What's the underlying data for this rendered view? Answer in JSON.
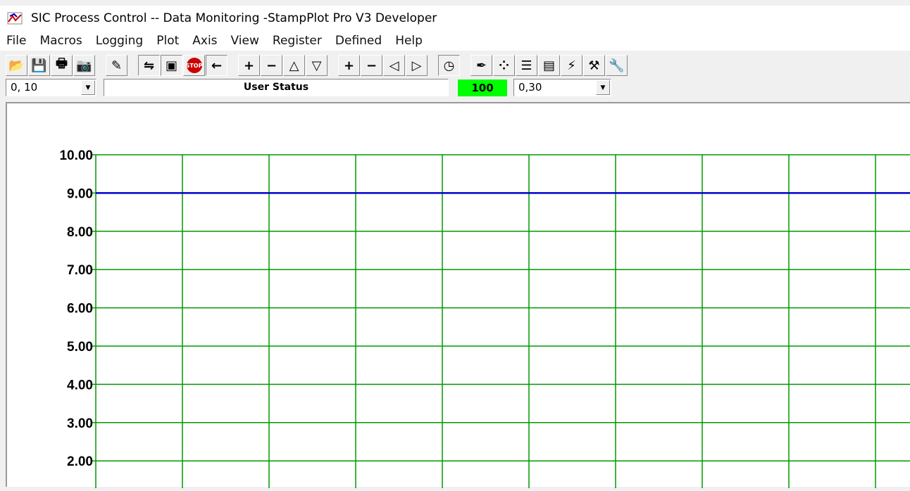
{
  "window": {
    "title": "SIC Process Control -- Data Monitoring  -StampPlot Pro V3 Developer"
  },
  "menu": [
    "File",
    "Macros",
    "Logging",
    "Plot",
    "Axis",
    "View",
    "Register",
    "Defined",
    "Help"
  ],
  "toolbar": [
    {
      "icon": "open-folder-icon",
      "glyph": "📂"
    },
    {
      "icon": "save-icon",
      "glyph": "💾"
    },
    {
      "icon": "print-icon",
      "glyph": "🖶"
    },
    {
      "icon": "camera-icon",
      "glyph": "📷"
    },
    {
      "gap": true
    },
    {
      "icon": "magic-wand-icon",
      "glyph": "✎"
    },
    {
      "gap": true
    },
    {
      "icon": "connect-icon",
      "glyph": "⇋",
      "pressed": true
    },
    {
      "icon": "monitor-icon",
      "glyph": "▣",
      "pressed": true
    },
    {
      "icon": "stop-icon",
      "glyph": "STOP"
    },
    {
      "icon": "arrow-left-icon",
      "glyph": "←",
      "pressed": true
    },
    {
      "gap": true
    },
    {
      "icon": "plus-y-icon",
      "glyph": "+"
    },
    {
      "icon": "minus-y-icon",
      "glyph": "−"
    },
    {
      "icon": "shift-up-icon",
      "glyph": "△"
    },
    {
      "icon": "shift-down-icon",
      "glyph": "▽"
    },
    {
      "gap": true
    },
    {
      "icon": "plus-x-icon",
      "glyph": "+"
    },
    {
      "icon": "minus-x-icon",
      "glyph": "−"
    },
    {
      "icon": "shift-left-icon",
      "glyph": "◁"
    },
    {
      "icon": "shift-right-icon",
      "glyph": "▷"
    },
    {
      "gap": true
    },
    {
      "icon": "clock-icon",
      "glyph": "◷",
      "pressed": true
    },
    {
      "gap": true
    },
    {
      "icon": "pen-icon",
      "glyph": "✒"
    },
    {
      "icon": "scatter-config-icon",
      "glyph": "⁘"
    },
    {
      "icon": "notes-icon",
      "glyph": "☰"
    },
    {
      "icon": "notebook-icon",
      "glyph": "▤"
    },
    {
      "icon": "probe-icon",
      "glyph": "⚡"
    },
    {
      "icon": "tools-icon",
      "glyph": "⚒"
    },
    {
      "icon": "wrench-icon",
      "glyph": "🔧"
    }
  ],
  "status": {
    "y_range": "0, 10",
    "user_status": "User Status",
    "value": "100",
    "x_range": "0,30",
    "value_color": "#00ff00"
  },
  "chart_data": {
    "type": "line",
    "y_ticks": [
      "10.00",
      "9.00",
      "8.00",
      "7.00",
      "6.00",
      "5.00",
      "4.00",
      "3.00",
      "2.00"
    ],
    "ylim": [
      0,
      10
    ],
    "grid": true,
    "grid_color": "#009900",
    "series": [
      {
        "color": "#0000cc",
        "values": [
          9,
          9
        ]
      }
    ],
    "x": [
      0,
      30
    ]
  }
}
